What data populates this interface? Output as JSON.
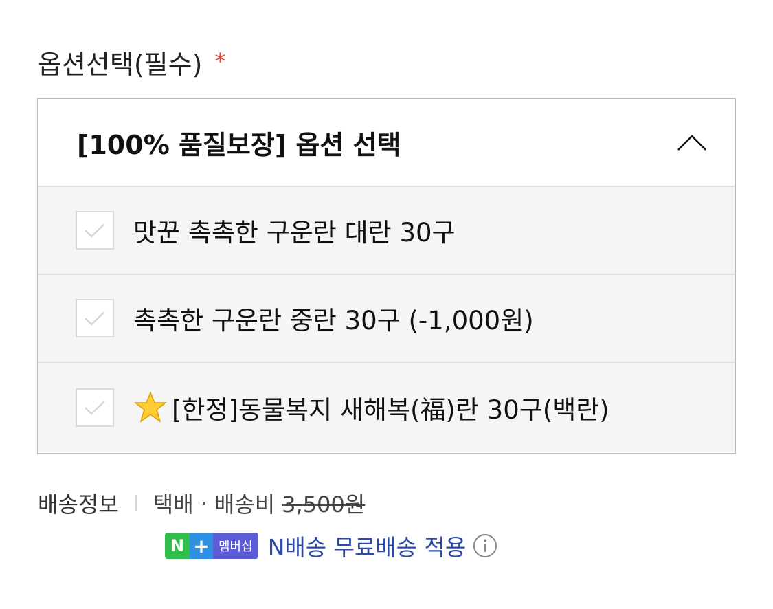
{
  "field": {
    "label": "옵션선택(필수)",
    "required_mark": "*"
  },
  "select": {
    "title": "[100% 품질보장] 옵션 선택",
    "expanded": true,
    "options": [
      {
        "label": "맛꾼 촉촉한 구운란 대란 30구",
        "checked": false
      },
      {
        "label": "촉촉한 구운란 중란 30구 (-1,000원)",
        "checked": false
      },
      {
        "label": "[한정]동물복지 새해복(福)란 30구(백란)",
        "checked": false,
        "icon": "star-icon"
      }
    ]
  },
  "shipping": {
    "label": "배송정보",
    "method": "택배",
    "dot": "·",
    "fee_label": "배송비",
    "fee_original": "3,500원"
  },
  "membership": {
    "badge_n": "N",
    "badge_plus": "+",
    "badge_text": "멤버십",
    "text": "N배송 무료배송 적용"
  },
  "colors": {
    "required": "#e24a3b",
    "membership_text": "#2b4aa8",
    "badge_green": "#2fbf4a",
    "badge_blue": "#2f8fe3",
    "badge_purple": "#5b5bd6"
  }
}
